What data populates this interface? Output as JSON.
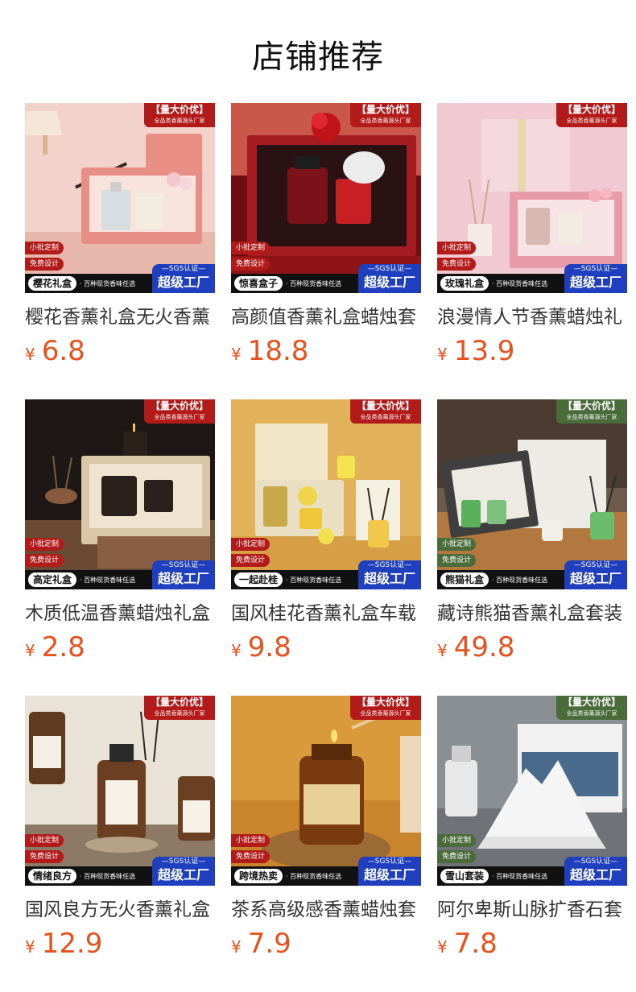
{
  "header": {
    "title": "店铺推荐"
  },
  "badge": {
    "top_main": "【量大价优】",
    "top_sub": "全品类香薰源头厂家",
    "small_batch": "小批定制",
    "free_design": "免费设计",
    "sub_text": "· 百种现货香味任选",
    "sgs": "—SGS认证—",
    "factory": "超级工厂"
  },
  "products": [
    {
      "name": "樱花礼盒",
      "title": "樱花香薰礼盒无火香薰",
      "price": "6.8",
      "currency": "¥",
      "tag_color": "red"
    },
    {
      "name": "惊喜盒子",
      "title": "高颜值香薰礼盒蜡烛套",
      "price": "18.8",
      "currency": "¥",
      "tag_color": "red"
    },
    {
      "name": "玫瑰礼盒",
      "title": "浪漫情人节香薰蜡烛礼",
      "price": "13.9",
      "currency": "¥",
      "tag_color": "red"
    },
    {
      "name": "高定礼盒",
      "title": "木质低温香薰蜡烛礼盒",
      "price": "2.8",
      "currency": "¥",
      "tag_color": "red"
    },
    {
      "name": "一起赴桂",
      "title": "国风桂花香薰礼盒车载",
      "price": "9.8",
      "currency": "¥",
      "tag_color": "red"
    },
    {
      "name": "熊猫礼盒",
      "title": "藏诗熊猫香薰礼盒套装",
      "price": "49.8",
      "currency": "¥",
      "tag_color": "green"
    },
    {
      "name": "情绪良方",
      "title": "国风良方无火香薰礼盒",
      "price": "12.9",
      "currency": "¥",
      "tag_color": "red"
    },
    {
      "name": "跨境热卖",
      "title": "茶系高级感香薰蜡烛套",
      "price": "7.9",
      "currency": "¥",
      "tag_color": "red"
    },
    {
      "name": "雪山套装",
      "title": "阿尔卑斯山脉扩香石套",
      "price": "7.8",
      "currency": "¥",
      "tag_color": "green"
    }
  ],
  "colors": {
    "price": "#e8501c",
    "tag_red": "#b31b1b",
    "tag_green": "#4a6b3a",
    "factory_blue": "#1f3fbf"
  }
}
